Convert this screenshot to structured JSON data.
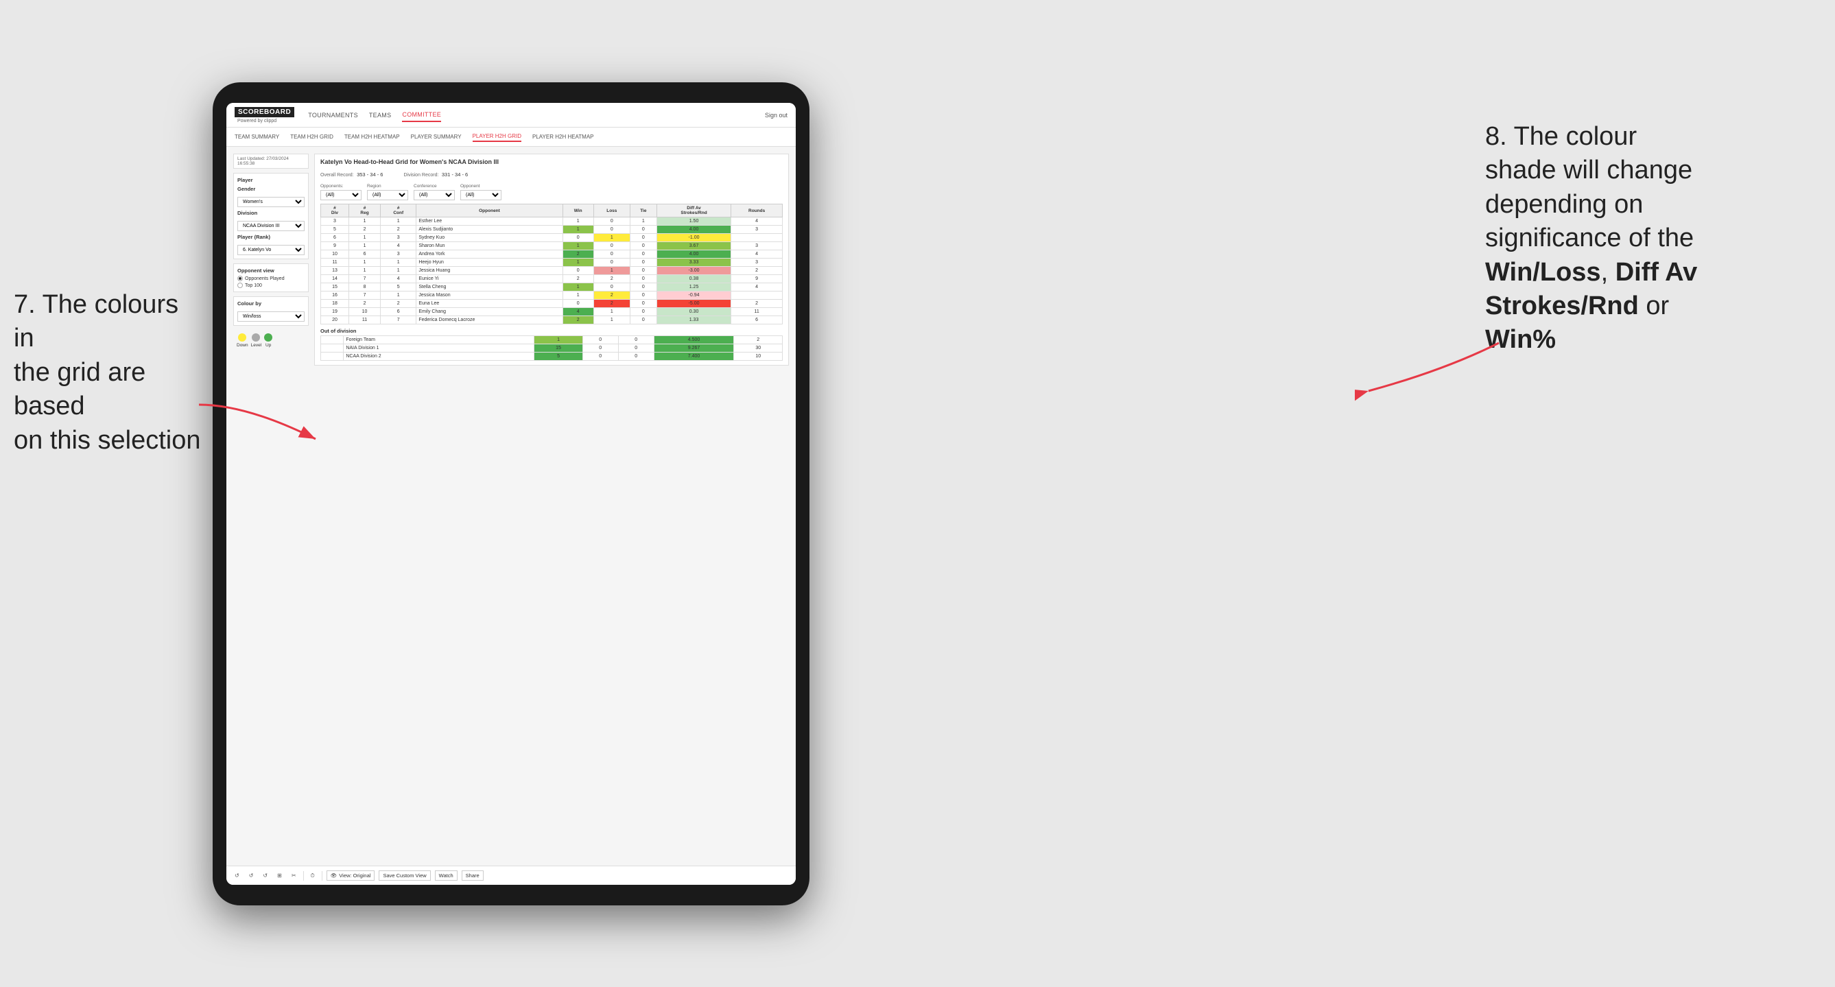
{
  "annotations": {
    "left": {
      "line1": "7. The colours in",
      "line2": "the grid are based",
      "line3": "on this selection"
    },
    "right": {
      "line1": "8. The colour",
      "line2": "shade will change",
      "line3": "depending on",
      "line4": "significance of the",
      "bold1": "Win/Loss",
      "comma": ", ",
      "bold2": "Diff Av",
      "line5": "Strokes/Rnd",
      "line6": "or",
      "bold3": "Win%"
    }
  },
  "nav": {
    "logo": "SCOREBOARD",
    "logo_sub": "Powered by clippd",
    "items": [
      "TOURNAMENTS",
      "TEAMS",
      "COMMITTEE"
    ],
    "active": "COMMITTEE",
    "sign_out": "Sign out"
  },
  "sub_nav": {
    "items": [
      "TEAM SUMMARY",
      "TEAM H2H GRID",
      "TEAM H2H HEATMAP",
      "PLAYER SUMMARY",
      "PLAYER H2H GRID",
      "PLAYER H2H HEATMAP"
    ],
    "active": "PLAYER H2H GRID"
  },
  "left_panel": {
    "last_updated_label": "Last Updated: 27/03/2024",
    "last_updated_time": "16:55:38",
    "player_label": "Player",
    "gender_label": "Gender",
    "gender_value": "Women's",
    "division_label": "Division",
    "division_value": "NCAA Division III",
    "player_rank_label": "Player (Rank)",
    "player_rank_value": "6. Katelyn Vo",
    "opponent_view_label": "Opponent view",
    "radio1": "Opponents Played",
    "radio2": "Top 100",
    "colour_by_label": "Colour by",
    "colour_by_value": "Win/loss",
    "legend_down": "Down",
    "legend_level": "Level",
    "legend_up": "Up"
  },
  "grid": {
    "title": "Katelyn Vo Head-to-Head Grid for Women's NCAA Division III",
    "overall_record_label": "Overall Record:",
    "overall_record_value": "353 - 34 - 6",
    "division_record_label": "Division Record:",
    "division_record_value": "331 - 34 - 6",
    "opponents_label": "Opponents:",
    "opponents_value": "(All)",
    "region_label": "Region",
    "region_value": "(All)",
    "conference_label": "Conference",
    "conference_value": "(All)",
    "opponent_label": "Opponent",
    "opponent_value": "(All)",
    "columns": [
      "#Div",
      "#Reg",
      "#Conf",
      "Opponent",
      "Win",
      "Loss",
      "Tie",
      "Diff Av Strokes/Rnd",
      "Rounds"
    ],
    "rows": [
      {
        "div": "3",
        "reg": "1",
        "conf": "1",
        "name": "Esther Lee",
        "win": "1",
        "loss": "0",
        "tie": "1",
        "diff": "1.50",
        "rounds": "4",
        "win_color": "plain",
        "loss_color": "plain",
        "tie_color": "plain",
        "diff_color": "green_light"
      },
      {
        "div": "5",
        "reg": "2",
        "conf": "2",
        "name": "Alexis Sudjianto",
        "win": "1",
        "loss": "0",
        "tie": "0",
        "diff": "4.00",
        "rounds": "3",
        "win_color": "green_medium",
        "diff_color": "green_dark"
      },
      {
        "div": "6",
        "reg": "1",
        "conf": "3",
        "name": "Sydney Kuo",
        "win": "0",
        "loss": "1",
        "tie": "0",
        "diff": "-1.00",
        "rounds": "",
        "win_color": "plain",
        "loss_color": "yellow",
        "diff_color": "yellow"
      },
      {
        "div": "9",
        "reg": "1",
        "conf": "4",
        "name": "Sharon Mun",
        "win": "1",
        "loss": "0",
        "tie": "0",
        "diff": "3.67",
        "rounds": "3",
        "win_color": "green_medium",
        "diff_color": "green_medium"
      },
      {
        "div": "10",
        "reg": "6",
        "conf": "3",
        "name": "Andrea York",
        "win": "2",
        "loss": "0",
        "tie": "0",
        "diff": "4.00",
        "rounds": "4",
        "win_color": "green_dark",
        "diff_color": "green_dark"
      },
      {
        "div": "11",
        "reg": "1",
        "conf": "1",
        "name": "Heejo Hyun",
        "win": "1",
        "loss": "0",
        "tie": "0",
        "diff": "3.33",
        "rounds": "3",
        "win_color": "green_medium",
        "diff_color": "green_medium"
      },
      {
        "div": "13",
        "reg": "1",
        "conf": "1",
        "name": "Jessica Huang",
        "win": "0",
        "loss": "1",
        "tie": "0",
        "diff": "-3.00",
        "rounds": "2",
        "win_color": "plain",
        "loss_color": "red_medium",
        "diff_color": "red_medium"
      },
      {
        "div": "14",
        "reg": "7",
        "conf": "4",
        "name": "Eunice Yi",
        "win": "2",
        "loss": "2",
        "tie": "0",
        "diff": "0.38",
        "rounds": "9",
        "win_color": "plain",
        "diff_color": "green_light"
      },
      {
        "div": "15",
        "reg": "8",
        "conf": "5",
        "name": "Stella Cheng",
        "win": "1",
        "loss": "0",
        "tie": "0",
        "diff": "1.25",
        "rounds": "4",
        "win_color": "green_medium",
        "diff_color": "green_light"
      },
      {
        "div": "16",
        "reg": "7",
        "conf": "1",
        "name": "Jessica Mason",
        "win": "1",
        "loss": "2",
        "tie": "0",
        "diff": "-0.94",
        "rounds": "",
        "win_color": "plain",
        "loss_color": "yellow",
        "diff_color": "red_light"
      },
      {
        "div": "18",
        "reg": "2",
        "conf": "2",
        "name": "Euna Lee",
        "win": "0",
        "loss": "2",
        "tie": "0",
        "diff": "-5.00",
        "rounds": "2",
        "win_color": "plain",
        "loss_color": "red_dark",
        "diff_color": "red_dark"
      },
      {
        "div": "19",
        "reg": "10",
        "conf": "6",
        "name": "Emily Chang",
        "win": "4",
        "loss": "1",
        "tie": "0",
        "diff": "0.30",
        "rounds": "11",
        "win_color": "green_dark",
        "diff_color": "green_light"
      },
      {
        "div": "20",
        "reg": "11",
        "conf": "7",
        "name": "Federica Domecq Lacroze",
        "win": "2",
        "loss": "1",
        "tie": "0",
        "diff": "1.33",
        "rounds": "6",
        "win_color": "green_medium",
        "diff_color": "green_light"
      }
    ],
    "out_of_division_label": "Out of division",
    "out_rows": [
      {
        "name": "Foreign Team",
        "win": "1",
        "loss": "0",
        "tie": "0",
        "diff": "4.500",
        "rounds": "2",
        "win_color": "green_medium",
        "diff_color": "green_dark"
      },
      {
        "name": "NAIA Division 1",
        "win": "15",
        "loss": "0",
        "tie": "0",
        "diff": "9.267",
        "rounds": "30",
        "win_color": "green_dark",
        "diff_color": "green_dark"
      },
      {
        "name": "NCAA Division 2",
        "win": "5",
        "loss": "0",
        "tie": "0",
        "diff": "7.400",
        "rounds": "10",
        "win_color": "green_dark",
        "diff_color": "green_dark"
      }
    ]
  },
  "toolbar": {
    "view_original": "View: Original",
    "save_custom_view": "Save Custom View",
    "watch": "Watch",
    "share": "Share"
  }
}
